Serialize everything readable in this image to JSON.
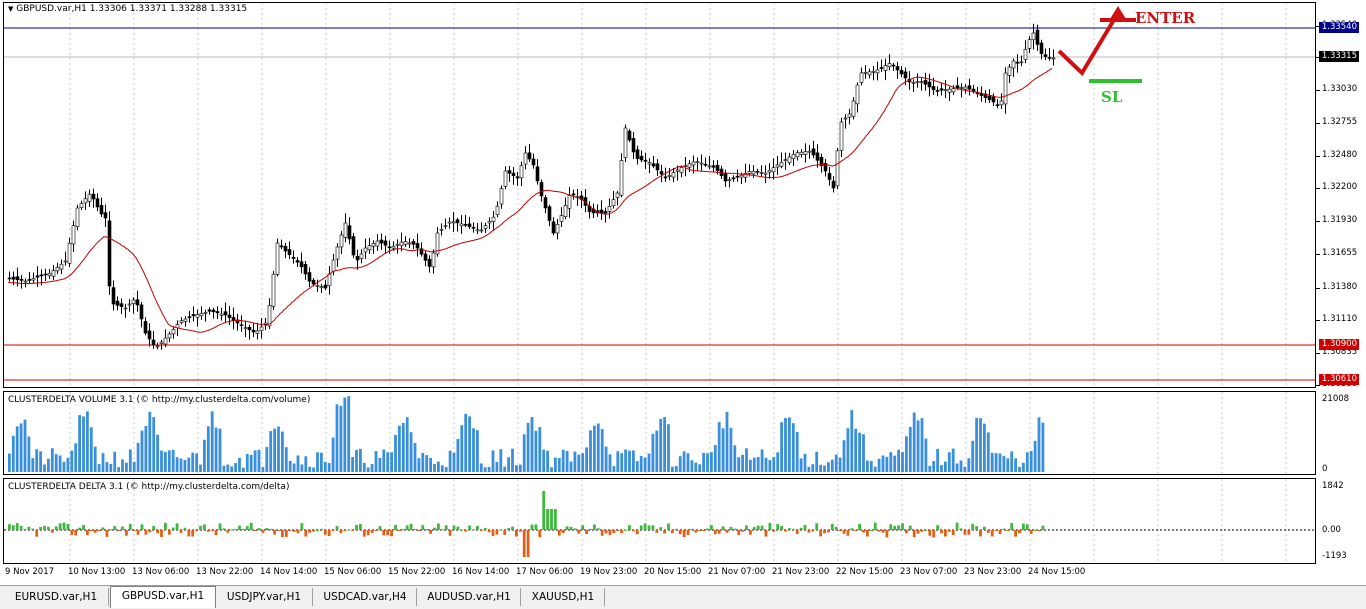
{
  "window": {
    "symbol_info": "GBPUSD.var,H1  1.33306 1.33371 1.33288 1.33315",
    "menu_icon": "triangle-down-icon"
  },
  "price_axis": {
    "labels": [
      "1.33540",
      "1.33315",
      "1.33030",
      "1.32755",
      "1.32480",
      "1.32200",
      "1.31930",
      "1.31655",
      "1.31380",
      "1.31110",
      "1.30835",
      "1.30580"
    ],
    "tags": {
      "top_line": "1.33540",
      "current": "1.33315",
      "line_1": "1.30900",
      "line_2": "1.30610"
    }
  },
  "indicators": {
    "volume": {
      "title": "CLUSTERDELTA VOLUME 3.1 (© http://my.clusterdelta.com/volume)",
      "max": "21008",
      "min": "0"
    },
    "delta": {
      "title": "CLUSTERDELTA DELTA 3.1 (© http://my.clusterdelta.com/delta)",
      "max": "1842",
      "zero": "0.00",
      "min": "-1193"
    }
  },
  "time_axis": [
    "9 Nov 2017",
    "10 Nov 13:00",
    "13 Nov 06:00",
    "13 Nov 22:00",
    "14 Nov 14:00",
    "15 Nov 06:00",
    "15 Nov 22:00",
    "16 Nov 14:00",
    "17 Nov 06:00",
    "19 Nov 23:00",
    "20 Nov 15:00",
    "21 Nov 07:00",
    "21 Nov 23:00",
    "22 Nov 15:00",
    "23 Nov 07:00",
    "23 Nov 23:00",
    "24 Nov 15:00"
  ],
  "annotations": {
    "enter": "ENTER",
    "sl": "SL"
  },
  "tabs": [
    {
      "label": "EURUSD.var,H1",
      "active": false
    },
    {
      "label": "GBPUSD.var,H1",
      "active": true
    },
    {
      "label": "USDJPY.var,H1",
      "active": false
    },
    {
      "label": "USDCAD.var,H4",
      "active": false
    },
    {
      "label": "AUDUSD.var,H1",
      "active": false
    },
    {
      "label": "XAUUSD,H1",
      "active": false
    }
  ],
  "colors": {
    "candle": "#000000",
    "ma": "#c00000",
    "hline_blue": "#00008b",
    "hline_red": "#d00000",
    "volume_bar": "#3a8fdc",
    "delta_pos": "#3cb83c",
    "delta_neg": "#e0601a",
    "enter": "#d01010",
    "sl": "#2ec02e"
  }
}
